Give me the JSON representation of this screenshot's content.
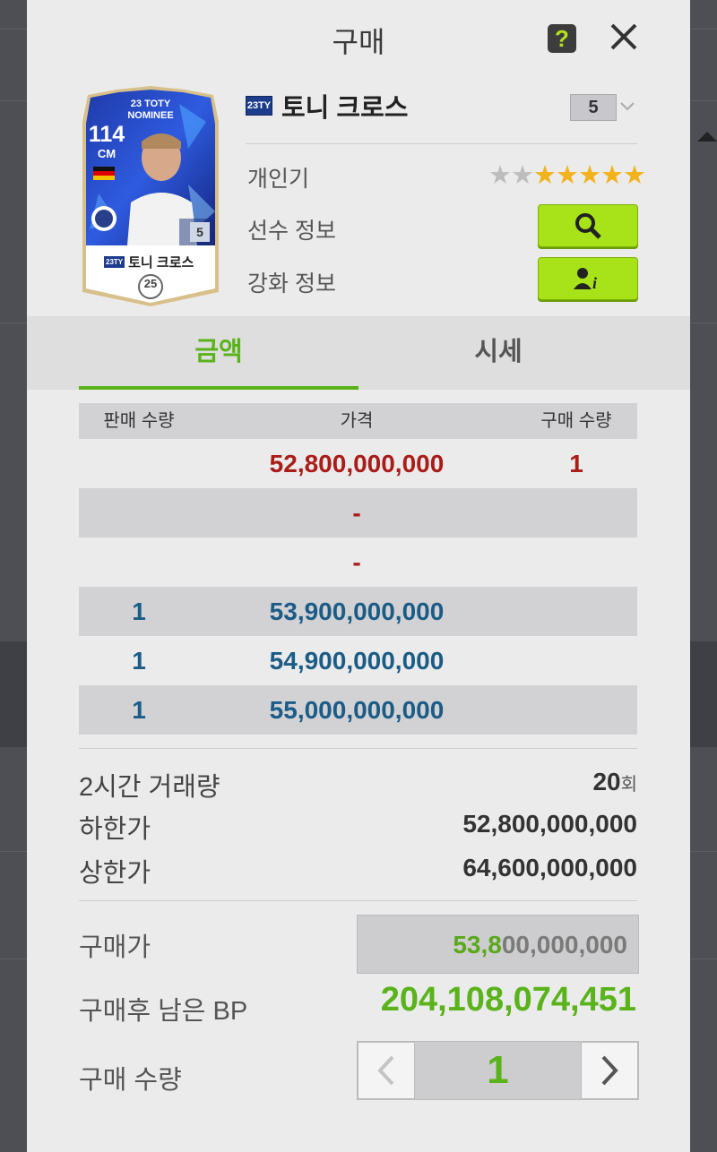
{
  "modal": {
    "title": "구매"
  },
  "player": {
    "season_badge": "23TY",
    "name": "토니 크로스",
    "level": "5",
    "card": {
      "ovr": "114",
      "position": "CM",
      "program_line1": "23 TOTY",
      "program_line2": "NOMINEE",
      "badge_level": "5",
      "name": "토니 크로스",
      "season_badge": "23TY",
      "pay": "25"
    }
  },
  "info": {
    "popularity_label": "개인기",
    "popularity_stars": 5,
    "popularity_max": 7,
    "player_info_label": "선수 정보",
    "enhance_info_label": "강화 정보"
  },
  "tabs": [
    {
      "label": "금액",
      "active": true
    },
    {
      "label": "시세",
      "active": false
    }
  ],
  "table": {
    "headers": [
      "판매 수량",
      "가격",
      "구매 수량"
    ],
    "rows": [
      {
        "sell_qty": "",
        "price": "52,800,000,000",
        "buy_qty": "1",
        "color": "red"
      },
      {
        "sell_qty": "",
        "price": "-",
        "buy_qty": "",
        "color": "red"
      },
      {
        "sell_qty": "",
        "price": "-",
        "buy_qty": "",
        "color": "red"
      },
      {
        "sell_qty": "1",
        "price": "53,900,000,000",
        "buy_qty": "",
        "color": "blue"
      },
      {
        "sell_qty": "1",
        "price": "54,900,000,000",
        "buy_qty": "",
        "color": "blue"
      },
      {
        "sell_qty": "1",
        "price": "55,000,000,000",
        "buy_qty": "",
        "color": "blue"
      }
    ]
  },
  "stats": {
    "volume_label": "2시간 거래량",
    "volume_value": "20",
    "volume_unit": "회",
    "lower_label": "하한가",
    "lower_value": "52,800,000,000",
    "upper_label": "상한가",
    "upper_value": "64,600,000,000"
  },
  "purchase": {
    "price_label": "구매가",
    "price_highlight": "53,8",
    "price_rest": "00,000,000",
    "remaining_label": "구매후 남은 BP",
    "remaining_value": "204,108,074,451",
    "qty_label": "구매 수량",
    "qty_value": "1"
  },
  "colors": {
    "accent_green": "#5ab31b",
    "button_green": "#a8e31a",
    "price_red": "#a91c17",
    "price_blue": "#1b5c87",
    "star_gold": "#f2b21b",
    "star_gray": "#bdbdbd"
  },
  "icons": {
    "help": "question-icon",
    "close": "close-icon",
    "search": "magnifier-icon",
    "enhance": "person-info-icon",
    "dropdown": "chevron-down-icon",
    "decrease": "chevron-left-icon",
    "increase": "chevron-right-icon"
  }
}
